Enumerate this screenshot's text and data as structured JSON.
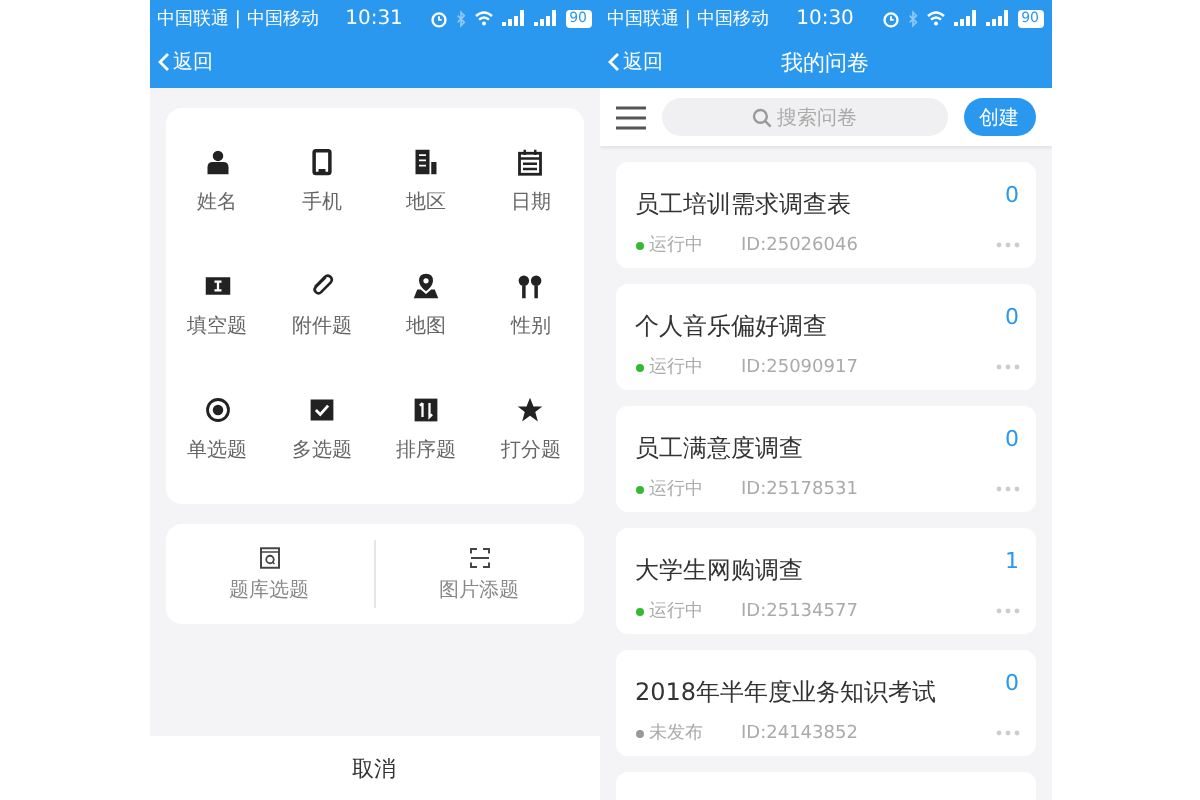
{
  "left_screen": {
    "status_bar": {
      "carrier": "中国联通 | 中国移动",
      "time": "10:31",
      "battery": "90"
    },
    "nav": {
      "back": "返回"
    },
    "field_types": [
      {
        "label": "姓名"
      },
      {
        "label": "手机"
      },
      {
        "label": "地区"
      },
      {
        "label": "日期"
      },
      {
        "label": "填空题"
      },
      {
        "label": "附件题"
      },
      {
        "label": "地图"
      },
      {
        "label": "性别"
      },
      {
        "label": "单选题"
      },
      {
        "label": "多选题"
      },
      {
        "label": "排序题"
      },
      {
        "label": "打分题"
      }
    ],
    "import_options": [
      {
        "label": "题库选题"
      },
      {
        "label": "图片添题"
      }
    ],
    "cancel": "取消"
  },
  "right_screen": {
    "status_bar": {
      "carrier": "中国联通 | 中国移动",
      "time": "10:30",
      "battery": "90"
    },
    "nav": {
      "back": "返回",
      "title": "我的问卷"
    },
    "search": {
      "placeholder": "搜索问卷"
    },
    "create_button": "创建",
    "surveys": [
      {
        "title": "员工培训需求调查表",
        "count": "0",
        "status": "运行中",
        "color": "#33b933",
        "id": "ID:25026046"
      },
      {
        "title": "个人音乐偏好调查",
        "count": "0",
        "status": "运行中",
        "color": "#33b933",
        "id": "ID:25090917"
      },
      {
        "title": "员工满意度调查",
        "count": "0",
        "status": "运行中",
        "color": "#33b933",
        "id": "ID:25178531"
      },
      {
        "title": "大学生网购调查",
        "count": "1",
        "status": "运行中",
        "color": "#33b933",
        "id": "ID:25134577"
      },
      {
        "title": "2018年半年度业务知识考试",
        "count": "0",
        "status": "未发布",
        "color": "#999999",
        "id": "ID:24143852"
      }
    ]
  }
}
